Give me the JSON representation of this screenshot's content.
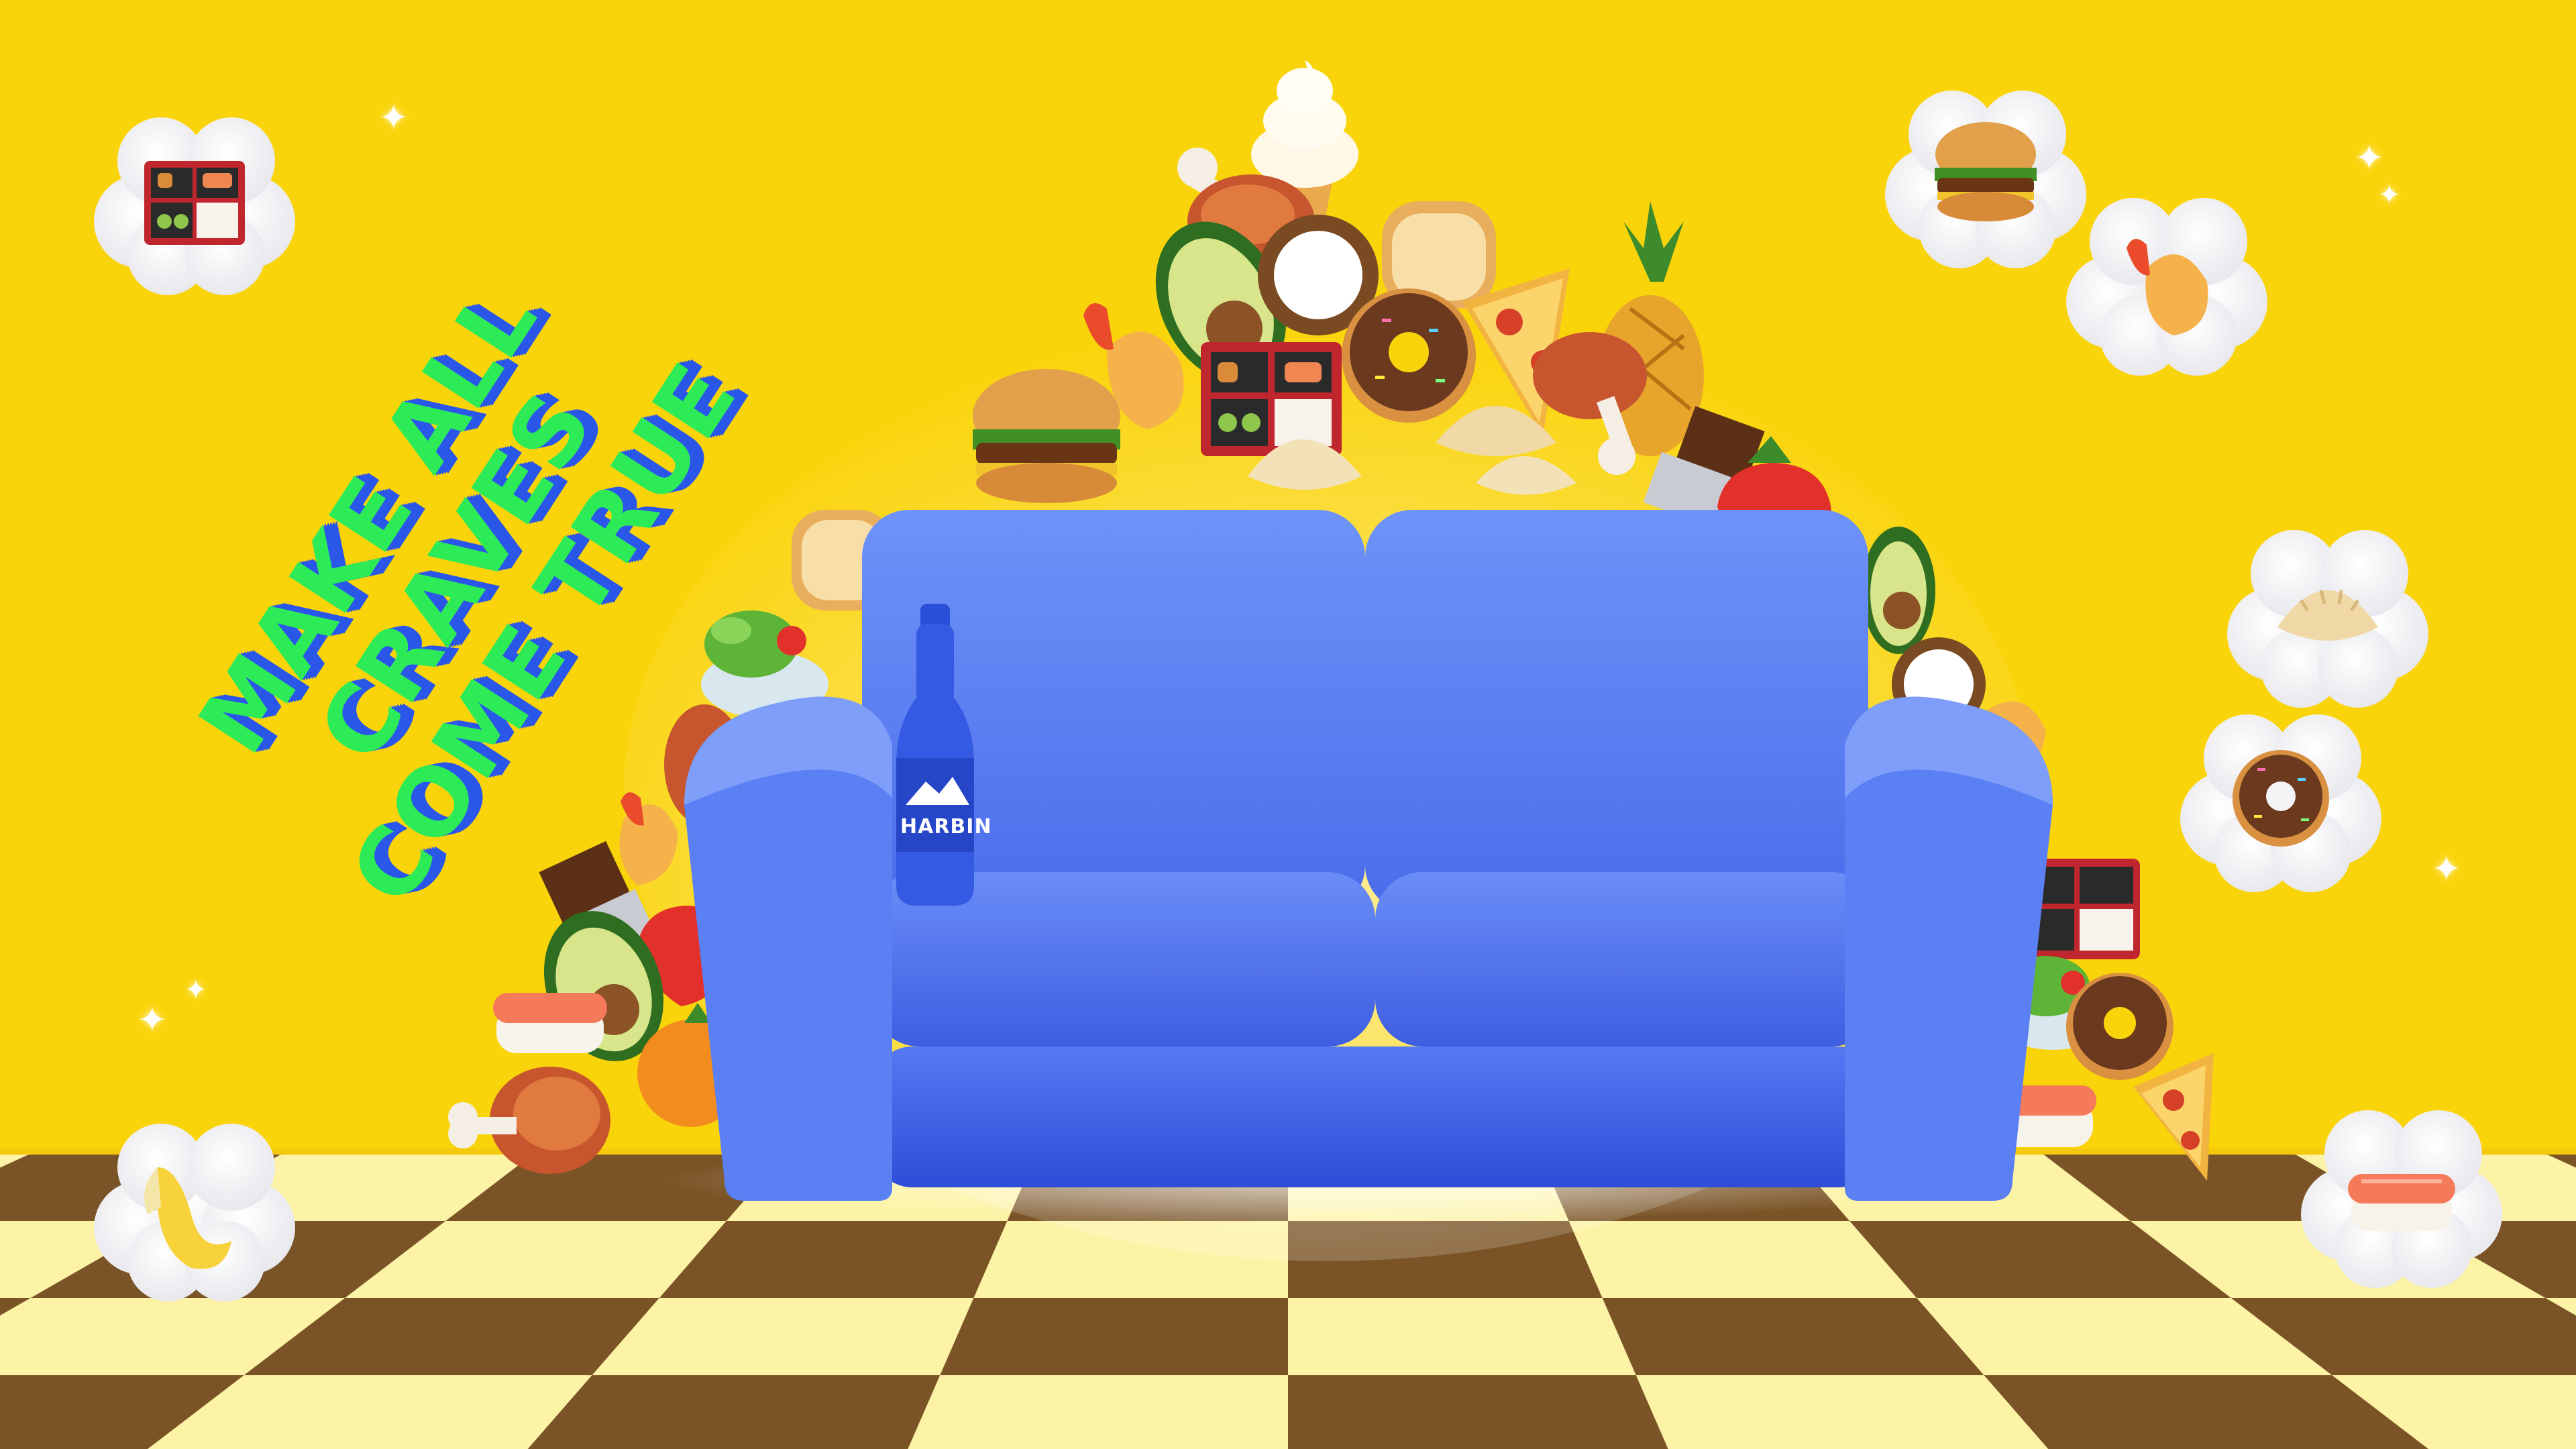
{
  "headline": {
    "line1": "MAKE ALL",
    "line2": "CRAVES",
    "line3": "COME TRUE"
  },
  "bottle": {
    "brand": "HARBIN"
  },
  "colors": {
    "background": "#FAD40B",
    "headline_fill": "#2DEB57",
    "headline_shadow": "#2A57E8",
    "sofa": "#4F78F0",
    "floor_light": "#FDF3A6",
    "floor_dark": "#7A5426"
  },
  "thought_clouds": [
    {
      "icon": "bento-box-icon"
    },
    {
      "icon": "hamburger-icon"
    },
    {
      "icon": "fried-shrimp-icon"
    },
    {
      "icon": "dumpling-icon"
    },
    {
      "icon": "donut-icon"
    },
    {
      "icon": "banana-icon"
    },
    {
      "icon": "sushi-icon"
    }
  ],
  "food_pile": [
    "soft-serve-icon",
    "meat-on-bone-icon",
    "avocado-icon",
    "coconut-icon",
    "bread-icon",
    "donut-icon",
    "pizza-icon",
    "pineapple-icon",
    "hamburger-icon",
    "bento-box-icon",
    "dumpling-icon",
    "chocolate-bar-icon",
    "strawberry-icon",
    "salad-icon",
    "orange-icon",
    "sushi-icon",
    "fried-shrimp-icon"
  ]
}
